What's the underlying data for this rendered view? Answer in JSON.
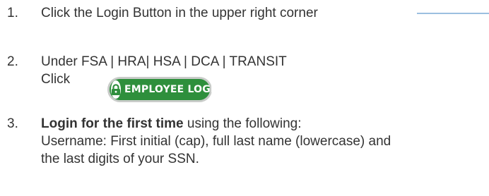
{
  "steps": [
    {
      "number": "1.",
      "text": "Click the Login Button in the upper right corner"
    },
    {
      "number": "2.",
      "line1": "Under FSA | HRA| HSA | DCA | TRANSIT",
      "line2": "Click"
    },
    {
      "number": "3.",
      "bold_text": "Login for the first time",
      "after_bold": " using the following:",
      "line2": "Username: First initial (cap), full last name (lowercase) and",
      "line3": "the last digits of your SSN."
    }
  ],
  "employee_login_button": {
    "label": "EMPLOYEE LOGIN",
    "icon": "lock-icon",
    "color": "#2e8f3c"
  },
  "colors": {
    "pointer_line": "#9bbfe0",
    "text": "#333333"
  }
}
